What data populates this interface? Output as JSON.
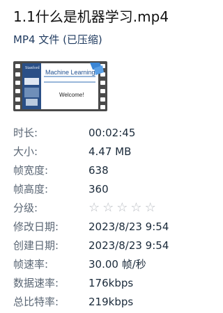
{
  "file": {
    "title": "1.1什么是机器学习.mp4",
    "type": "MP4 文件 (已压缩)"
  },
  "thumbnail": {
    "slide_title": "Machine Learning",
    "slide_text": "Welcome!",
    "side_text": "Stanford",
    "icon": "video-file-icon"
  },
  "properties": [
    {
      "label": "时长:",
      "value": "00:02:45"
    },
    {
      "label": "大小:",
      "value": "4.47 MB"
    },
    {
      "label": "帧宽度:",
      "value": "638"
    },
    {
      "label": "帧高度:",
      "value": "360"
    },
    {
      "label": "分级:",
      "value": ""
    },
    {
      "label": "修改日期:",
      "value": "2023/8/23 9:54"
    },
    {
      "label": "创建日期:",
      "value": "2023/8/23 9:54"
    },
    {
      "label": "帧速率:",
      "value": "30.00 帧/秒"
    },
    {
      "label": "数据速率:",
      "value": "176kbps"
    },
    {
      "label": "总比特率:",
      "value": "219kbps"
    }
  ],
  "rating": {
    "stars_filled": 0,
    "stars_total": 5,
    "star_glyph": "☆"
  },
  "colors": {
    "film_strip": "#4a4a4a",
    "accent_blue": "#2f6db3",
    "badge_blue": "#3a86d6"
  }
}
